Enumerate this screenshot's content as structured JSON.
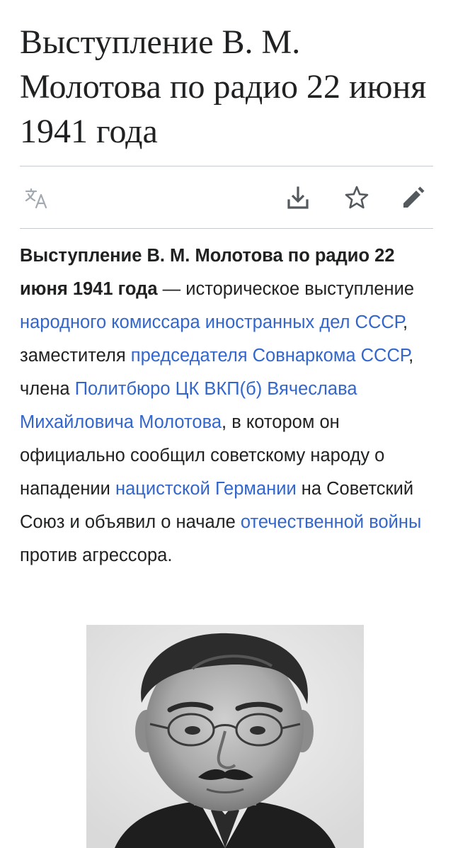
{
  "article": {
    "title": "Выступление В. М. Молотова по радио 22 июня 1941 года"
  },
  "toolbar": {
    "language_icon": "translate-icon",
    "download_icon": "download-icon",
    "watch_icon": "star-icon",
    "edit_icon": "pencil-icon"
  },
  "lead": {
    "bold_title": "Выступление В. М. Молотова по радио 22 июня 1941 года",
    "t1": " — историческое выступление ",
    "link1": "народного комиссара иностранных дел СССР",
    "t2": ", заместителя ",
    "link2": "председателя Совнаркома СССР",
    "t3": ", члена ",
    "link3": "Политбюро ЦК ВКП(б) Вячеслава Михайловича Молотова",
    "t4": ", в котором он официально сообщил советскому народу о нападении ",
    "link4": "нацистской Германии",
    "t5": " на Советский Союз и объявил о начале ",
    "link5": "отечественной войны",
    "t6": " против агрессора."
  },
  "colors": {
    "link": "#3366cc",
    "text": "#202122",
    "divider": "#c8ccd1",
    "icon": "#54595d",
    "icon_disabled": "#a2a9b1"
  }
}
